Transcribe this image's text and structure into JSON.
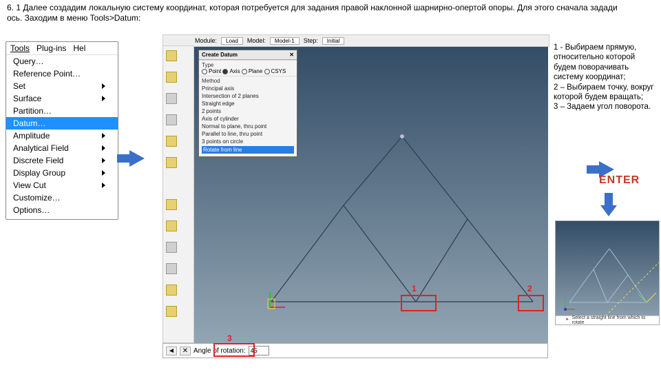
{
  "heading_line1": "6. 1 Далее создадим локальную систему координат, которая потребуется для задания правой наклонной шарнирно-опертой опоры. Для этого сначала задади",
  "heading_line2": "ось. Заходим в меню Tools>Datum:",
  "menubar": {
    "tools": "Tools",
    "plugins": "Plug-ins",
    "help": "Hel"
  },
  "menu": {
    "query": "Query…",
    "refpoint": "Reference Point…",
    "set": "Set",
    "surface": "Surface",
    "partition": "Partition…",
    "datum": "Datum…",
    "amplitude": "Amplitude",
    "analytical": "Analytical Field",
    "discrete": "Discrete Field",
    "displaygroup": "Display Group",
    "viewcut": "View Cut",
    "customize": "Customize…",
    "options": "Options…"
  },
  "toolbar_top": {
    "module_lbl": "Module:",
    "module": "Load",
    "model_lbl": "Model:",
    "model": "Model-1",
    "step_lbl": "Step:",
    "step": "Initial"
  },
  "dialog": {
    "title": "Create Datum",
    "type_lbl": "Type",
    "type_opts": [
      "Point",
      "Axis",
      "Plane",
      "CSYS"
    ],
    "method_lbl": "Method",
    "rows": [
      "Principal axis",
      "Intersection of 2 planes",
      "Straight edge",
      "2 points",
      "Axis of cylinder",
      "Normal to plane, thru point",
      "Parallel to line, thru point",
      "3 points on circle",
      "Rotate from line"
    ],
    "selected_idx": 8
  },
  "annotations": {
    "n1": "1",
    "n2": "2",
    "n3": "3"
  },
  "prompt": {
    "arrow_x": "✕",
    "label": "Angle of rotation:",
    "value": "45"
  },
  "rtext": "1 - Выбираем прямую, относительно которой будем поворачивать систему координат;\n2 – Выбираем точку, вокруг которой будем вращать;\n3 – Задаем угол поворота.",
  "enter": "ENTER",
  "result_status": "Select a straight line from which to rotate"
}
